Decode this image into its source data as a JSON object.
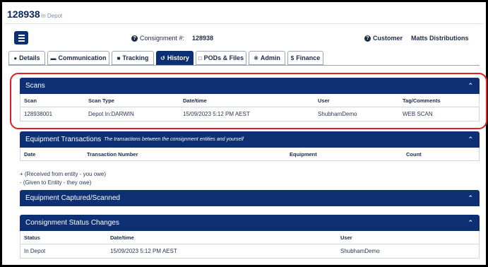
{
  "header": {
    "consignment_id": "128938",
    "status": "In Depot"
  },
  "info": {
    "consignment_label": "Consignment #:",
    "consignment_value": "128938",
    "customer_label": "Customer",
    "customer_value": "Matts Distributions"
  },
  "tabs": [
    {
      "label": "Details",
      "icon": "user-icon"
    },
    {
      "label": "Communication",
      "icon": "comment-icon"
    },
    {
      "label": "Tracking",
      "icon": "truck-icon"
    },
    {
      "label": "History",
      "icon": "history-icon",
      "active": true
    },
    {
      "label": "PODs & Files",
      "icon": "file-icon"
    },
    {
      "label": "Admin",
      "icon": "gear-icon"
    },
    {
      "label": "Finance",
      "icon": "dollar-icon"
    }
  ],
  "scans": {
    "title": "Scans",
    "columns": [
      "Scan",
      "Scan Type",
      "Date/time",
      "User",
      "Tag/Comments"
    ],
    "rows": [
      [
        "128938001",
        "Depot In:DARWIN",
        "15/09/2023 5:12 PM AEST",
        "ShubhamDemo",
        "WEB SCAN"
      ]
    ]
  },
  "equipment_transactions": {
    "title": "Equipment Transactions",
    "subtitle": "The transactions between the consignment entities and yourself",
    "columns": [
      "Date",
      "Transaction Number",
      "Equipment",
      "Count"
    ]
  },
  "legend": {
    "received": "+ (Received from entity - you owe)",
    "given": "- (Given to Entity - they owe)"
  },
  "equipment_captured": {
    "title": "Equipment Captured/Scanned"
  },
  "status_changes": {
    "title": "Consignment Status Changes",
    "columns": [
      "Status",
      "Date/time",
      "User"
    ],
    "rows": [
      [
        "In Depot",
        "15/09/2023 5:12 PM AEST",
        "ShubhamDemo"
      ]
    ]
  },
  "colors": {
    "primary": "#0d2f73",
    "highlight": "#e31b23"
  }
}
